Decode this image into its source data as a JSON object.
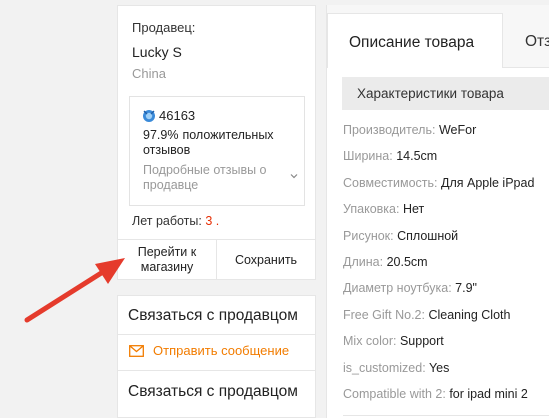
{
  "seller": {
    "label": "Продавец:",
    "name": "Lucky S",
    "country": "China",
    "score": "46163",
    "positive_pct": "97.9%",
    "positive_text": "положительных отзывов",
    "reviews_link": "Подробные отзывы о продавце",
    "years_label": "Лет работы:",
    "years_value": "3 .",
    "go_store_button": "Перейти к магазину",
    "save_button": "Сохранить"
  },
  "contact": {
    "title_1": "Связаться с продавцом",
    "send_message": "Отправить сообщение",
    "title_2": "Связаться с продавцом"
  },
  "tabs": {
    "active": "Описание товара",
    "other": "Отз"
  },
  "specs": {
    "header": "Характеристики товара",
    "rows": [
      {
        "key": "Производитель:",
        "value": "WeFor"
      },
      {
        "key": "Ширина:",
        "value": "14.5cm"
      },
      {
        "key": "Совместимость:",
        "value": "Для Apple iPpad"
      },
      {
        "key": "Упаковка:",
        "value": "Нет"
      },
      {
        "key": "Рисунок:",
        "value": "Сплошной"
      },
      {
        "key": "Длина:",
        "value": "20.5cm"
      },
      {
        "key": "Диаметр ноутбука:",
        "value": "7.9\""
      },
      {
        "key": "Free Gift No.2:",
        "value": "Cleaning Cloth"
      },
      {
        "key": "Mix color:",
        "value": "Support"
      },
      {
        "key": "is_customized:",
        "value": "Yes"
      },
      {
        "key": "Compatible with 2:",
        "value": "for ipad mini 2"
      }
    ]
  },
  "colors": {
    "accent_red": "#e62e04",
    "link_orange": "#f27c00",
    "annotation_arrow": "#e53b2c",
    "medal_blue": "#3a8ad9"
  }
}
